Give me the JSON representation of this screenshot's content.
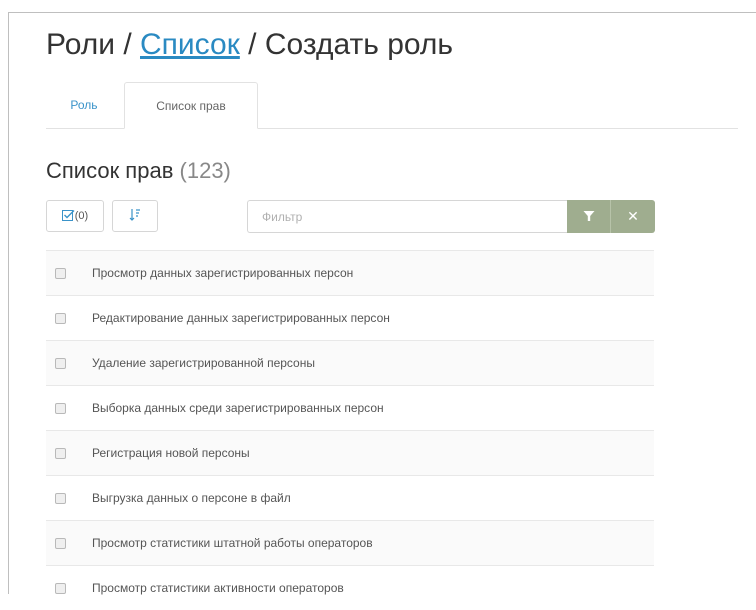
{
  "breadcrumb": {
    "root": "Роли",
    "sep1": " / ",
    "link": "Список",
    "sep2": " / ",
    "current": "Создать роль"
  },
  "tabs": [
    {
      "label": "Роль",
      "active": false
    },
    {
      "label": "Список прав",
      "active": true
    }
  ],
  "section": {
    "title": "Список прав",
    "count": "(123)"
  },
  "toolbar": {
    "selected_count": "(0)",
    "check_icon": "checkbox-icon",
    "sort_icon": "sort-icon",
    "filter_placeholder": "Фильтр",
    "filter_icon": "funnel-icon",
    "clear_icon": "close-icon",
    "accent_color": "#9fad8f"
  },
  "permissions": [
    "Просмотр данных зарегистрированных персон",
    "Редактирование данных зарегистрированных персон",
    "Удаление зарегистрированной персоны",
    "Выборка данных среди зарегистрированных персон",
    "Регистрация новой персоны",
    "Выгрузка данных о персоне в файл",
    "Просмотр статистики штатной работы операторов",
    "Просмотр статистики активности операторов"
  ]
}
